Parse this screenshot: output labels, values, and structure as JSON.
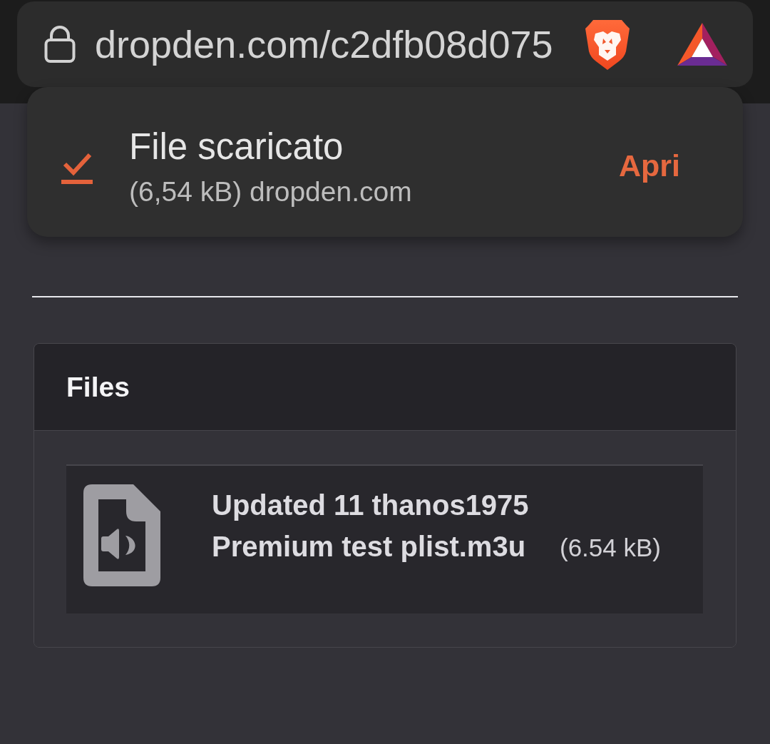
{
  "address_bar": {
    "url": "dropden.com/c2dfb08d075"
  },
  "download_notice": {
    "title": "File scaricato",
    "detail": "(6,54 kB) dropden.com",
    "action": "Apri"
  },
  "files_panel": {
    "title": "Files",
    "files": [
      {
        "name": "Updated 11 thanos1975 Premium test plist.m3u",
        "size": "(6.54 kB)"
      }
    ]
  }
}
